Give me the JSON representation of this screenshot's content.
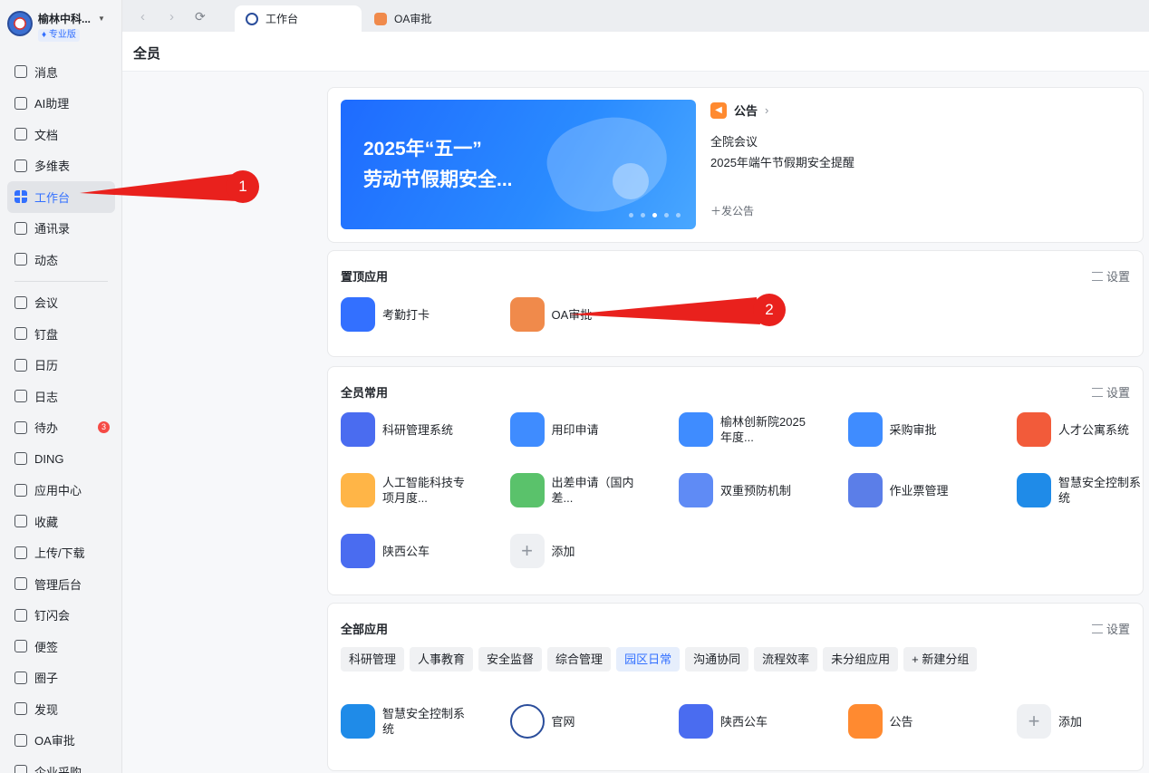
{
  "sidebar": {
    "org_name": "榆林中科...",
    "org_badge": "专业版",
    "items": [
      {
        "label": "消息"
      },
      {
        "label": "AI助理"
      },
      {
        "label": "文档"
      },
      {
        "label": "多维表"
      },
      {
        "label": "工作台",
        "active": true
      },
      {
        "label": "通讯录"
      },
      {
        "label": "动态"
      },
      {
        "label": "会议"
      },
      {
        "label": "钉盘"
      },
      {
        "label": "日历"
      },
      {
        "label": "日志"
      },
      {
        "label": "待办",
        "badge": "3"
      },
      {
        "label": "DING"
      },
      {
        "label": "应用中心"
      },
      {
        "label": "收藏"
      },
      {
        "label": "上传/下载"
      },
      {
        "label": "管理后台"
      },
      {
        "label": "钉闪会"
      },
      {
        "label": "便签"
      },
      {
        "label": "圈子"
      },
      {
        "label": "发现"
      },
      {
        "label": "OA审批"
      },
      {
        "label": "企业采购"
      }
    ]
  },
  "tabs": [
    {
      "label": "工作台",
      "active": true
    },
    {
      "label": "OA审批"
    }
  ],
  "page_title": "全员",
  "banner": {
    "line1": "2025年“五一”",
    "line2": "劳动节假期安全..."
  },
  "notice": {
    "title": "公告",
    "items": [
      "全院会议",
      "2025年端午节假期安全提醒"
    ],
    "post_label": "发公告"
  },
  "pinned": {
    "title": "置顶应用",
    "setting": "设置",
    "apps": [
      {
        "label": "考勤打卡",
        "color": "#3370ff"
      },
      {
        "label": "OA审批",
        "color": "#f08a4b"
      }
    ]
  },
  "common": {
    "title": "全员常用",
    "setting": "设置",
    "apps": [
      {
        "label": "科研管理系统",
        "color": "#4a6cf0"
      },
      {
        "label": "用印申请",
        "color": "#3f8cff"
      },
      {
        "label": "榆林创新院2025年度...",
        "color": "#3f8cff"
      },
      {
        "label": "采购审批",
        "color": "#3f8cff"
      },
      {
        "label": "人才公寓系统",
        "color": "#f25b3a"
      },
      {
        "label": "人工智能科技专项月度...",
        "color": "#ffb547"
      },
      {
        "label": "出差申请（国内差...",
        "color": "#5ac26b"
      },
      {
        "label": "双重预防机制",
        "color": "#5f8bf5"
      },
      {
        "label": "作业票管理",
        "color": "#5b7ee8"
      },
      {
        "label": "智慧安全控制系统",
        "color": "#1f8be8"
      },
      {
        "label": "陕西公车",
        "color": "#4a6cf0"
      },
      {
        "label": "添加",
        "color": "#eef0f3"
      }
    ]
  },
  "all": {
    "title": "全部应用",
    "setting": "设置",
    "groups": [
      "科研管理",
      "人事教育",
      "安全监督",
      "综合管理",
      "园区日常",
      "沟通协同",
      "流程效率",
      "未分组应用",
      "+ 新建分组"
    ],
    "active_group": "园区日常",
    "apps": [
      {
        "label": "智慧安全控制系统",
        "color": "#1f8be8"
      },
      {
        "label": "官网",
        "color": "#ffffff"
      },
      {
        "label": "陕西公车",
        "color": "#4a6cf0"
      },
      {
        "label": "公告",
        "color": "#ff8a30"
      },
      {
        "label": "添加",
        "color": "#eef0f3"
      }
    ]
  },
  "annotations": [
    "1",
    "2"
  ]
}
